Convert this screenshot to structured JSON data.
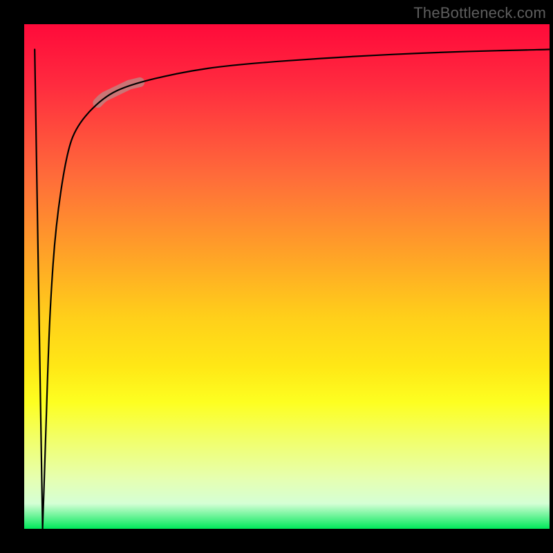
{
  "attribution": "TheBottleneck.com",
  "chart_data": {
    "type": "line",
    "title": "",
    "xlabel": "",
    "ylabel": "",
    "x": [
      3.5,
      4,
      4.5,
      5,
      6,
      8,
      10,
      15,
      20,
      30,
      40,
      60,
      80,
      100
    ],
    "values": [
      0,
      15,
      32,
      45,
      60,
      74,
      80,
      85.5,
      88,
      90.5,
      92,
      93.5,
      94.5,
      95
    ],
    "highlight_range_x": [
      14,
      22
    ],
    "xlim": [
      0,
      100
    ],
    "ylim": [
      0,
      100
    ],
    "background_gradient": {
      "top": "#ff0a3a",
      "mid": "#ffe816",
      "bottom": "#00e85a"
    }
  }
}
